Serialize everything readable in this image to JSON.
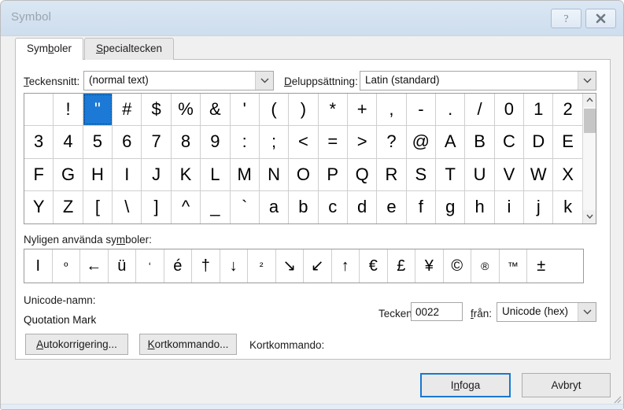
{
  "window": {
    "title": "Symbol",
    "help_button": "?",
    "close_button": "✕"
  },
  "tabs": [
    {
      "label": "Symboler",
      "accesskey": "b",
      "active": true
    },
    {
      "label": "Specialtecken",
      "accesskey": "S",
      "active": false
    }
  ],
  "font_row": {
    "font_label": "Teckensnitt:",
    "font_label_accesskey": "T",
    "font_value": "(normal text)",
    "subset_label": "Deluppsättning:",
    "subset_label_accesskey": "D",
    "subset_value": "Latin (standard)"
  },
  "symbol_grid": {
    "columns": 19,
    "selected_char": "\"",
    "selected_index": 2,
    "rows": [
      [
        " ",
        "!",
        "\"",
        "#",
        "$",
        "%",
        "&",
        "'",
        "(",
        ")",
        "*",
        "+",
        ",",
        "-",
        ".",
        "/",
        "0",
        "1",
        "2"
      ],
      [
        "3",
        "4",
        "5",
        "6",
        "7",
        "8",
        "9",
        ":",
        ";",
        "<",
        "=",
        ">",
        "?",
        "@",
        "A",
        "B",
        "C",
        "D",
        "E"
      ],
      [
        "F",
        "G",
        "H",
        "I",
        "J",
        "K",
        "L",
        "M",
        "N",
        "O",
        "P",
        "Q",
        "R",
        "S",
        "T",
        "U",
        "V",
        "W",
        "X"
      ],
      [
        "Y",
        "Z",
        "[",
        "\\",
        "]",
        "^",
        "_",
        "`",
        "a",
        "b",
        "c",
        "d",
        "e",
        "f",
        "g",
        "h",
        "i",
        "j",
        "k"
      ]
    ],
    "scrollbar": {
      "up_arrow": "⌃",
      "down_arrow": "⌄"
    }
  },
  "recent": {
    "label": "Nyligen använda symboler:",
    "label_accesskey": "m",
    "symbols": [
      "Ι",
      "º",
      "←",
      "ü",
      "‘",
      "é",
      "†",
      "↓",
      "²",
      "↘",
      "↙",
      "↑",
      "€",
      "£",
      "¥",
      "©",
      "®",
      "™",
      "±"
    ],
    "small_symbols": [
      "º",
      "‘",
      "²",
      "®",
      "™"
    ]
  },
  "unicode": {
    "name_label": "Unicode-namn:",
    "name_value": "Quotation Mark",
    "charcode_label": "Teckenkod:",
    "charcode_value": "0022",
    "from_label": "från:",
    "from_label_accesskey": "f",
    "from_value": "Unicode (hex)"
  },
  "actions": {
    "autocorrect": "Autokorrigering...",
    "autocorrect_accesskey": "A",
    "shortcut_button": "Kortkommando...",
    "shortcut_button_accesskey": "K",
    "shortcut_label": "Kortkommando:",
    "shortcut_value": ""
  },
  "footer": {
    "insert": "Infoga",
    "insert_accesskey": "n",
    "cancel": "Avbryt"
  },
  "colors": {
    "titlebar": "#d3e1f0",
    "selection": "#1c7ad6",
    "default_button_border": "#1878d0",
    "dialog_bg": "#f0f0f0",
    "panel_bg": "#ffffff"
  }
}
